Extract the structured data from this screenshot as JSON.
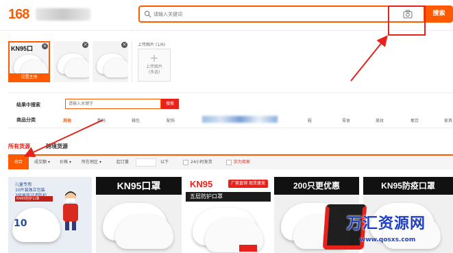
{
  "header": {
    "logo_text": "168",
    "search_placeholder": "请输入关键词",
    "search_button": "搜索"
  },
  "upload": {
    "thumb1_title": "KN95口",
    "thumb1_tag": "设置主体",
    "title": "上传图片 (1/6)",
    "box_label_1": "上传图片",
    "box_label_2": "(多选)"
  },
  "filters": {
    "search_in_results_label": "结果中搜索",
    "search_in_results_placeholder": "请输入关键字",
    "search_in_results_button": "搜索",
    "category_label": "商品分类",
    "categories": [
      "其他",
      "数码",
      "箱包",
      "配饰",
      "鞋",
      "零食",
      "美妆",
      "氧饮",
      "家具"
    ]
  },
  "source_tabs": {
    "all": "所有货源",
    "cross_border": "跨境货源"
  },
  "sortbar": {
    "items": [
      "综合",
      "成交额",
      "价格",
      "所在地区",
      "起订量",
      "以下",
      "24小时发货",
      "实力商家"
    ]
  },
  "products": [
    {
      "title_lines": [
        "儿童专用",
        "10片装独立包装",
        "3层高效过滤防护"
      ],
      "band": "KN95防护口罩",
      "count": "10"
    },
    {
      "banner": "KN95口罩"
    },
    {
      "banner": "KN95",
      "badge": "厂家直销 现货速发",
      "sub": "五层防护口罩"
    },
    {
      "banner": "200只更优惠"
    },
    {
      "banner": "KN95防疫口罩"
    }
  ],
  "watermark": {
    "title": "万汇资源网",
    "url": "www.qosxs.com"
  },
  "colors": {
    "brand_orange": "#ff5a00",
    "annotation_red": "#e8211a",
    "watermark_blue": "#2040c0"
  },
  "icons": [
    "search-icon",
    "camera-icon",
    "close-icon",
    "plus-icon",
    "chevron-down-icon",
    "checkbox-icon"
  ]
}
